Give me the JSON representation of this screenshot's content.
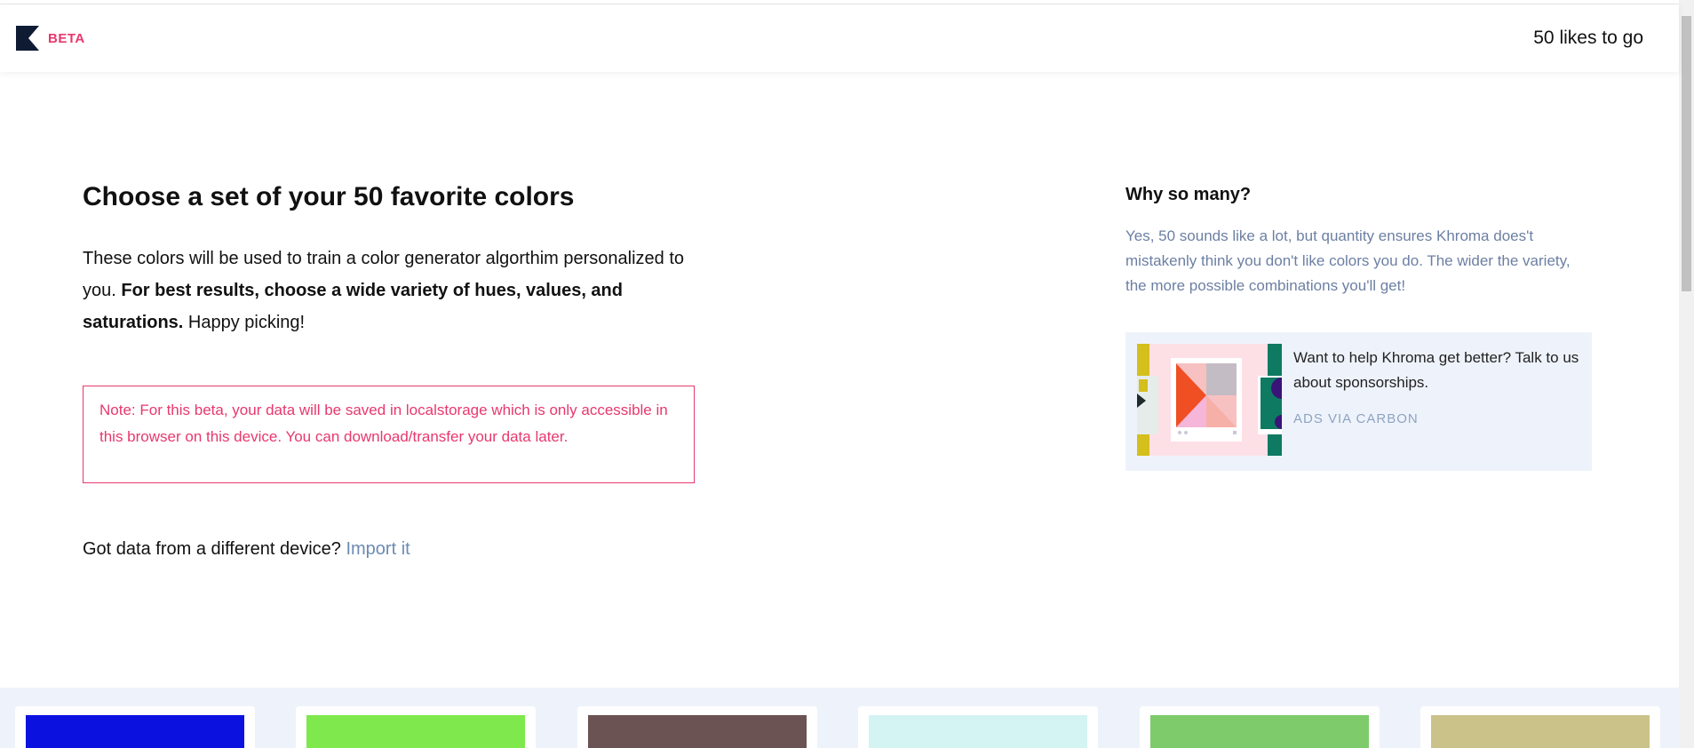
{
  "header": {
    "beta_label": "BETA",
    "likes_remaining": "50 likes to go",
    "logo_icon": "khroma-k-logo-icon"
  },
  "intro": {
    "title": "Choose a set of your 50 favorite colors",
    "lead_plain": "These colors will be used to train a color generator algorthim personalized to you. ",
    "lead_bold": "For best results, choose a wide variety of hues, values, and saturations.",
    "lead_tail": " Happy picking!"
  },
  "note": {
    "text": "Note: For this beta, your data will be saved in localstorage which is only accessible in this browser on this device. You can download/transfer your data later."
  },
  "import": {
    "question": "Got data from a different device? ",
    "link_label": "Import it"
  },
  "why": {
    "title": "Why so many?",
    "body": "Yes, 50 sounds like a lot, but quantity ensures Khroma does't mistakenly think you don't like colors you do. The wider the variety, the more possible combinations you'll get!"
  },
  "ad": {
    "copy": "Want to help Khroma get better? Talk to us about sponsorships.",
    "via": "ADS VIA CARBON"
  },
  "colors": {
    "accent": "#e8386d",
    "link": "#6c8bb3",
    "muted_text": "#6c7fa3",
    "panel_bg": "#eef3fb",
    "swatches": [
      "#0b12e0",
      "#7ee84d",
      "#6b5353",
      "#d4f3f3",
      "#7ecb6b",
      "#cbc28a"
    ]
  }
}
